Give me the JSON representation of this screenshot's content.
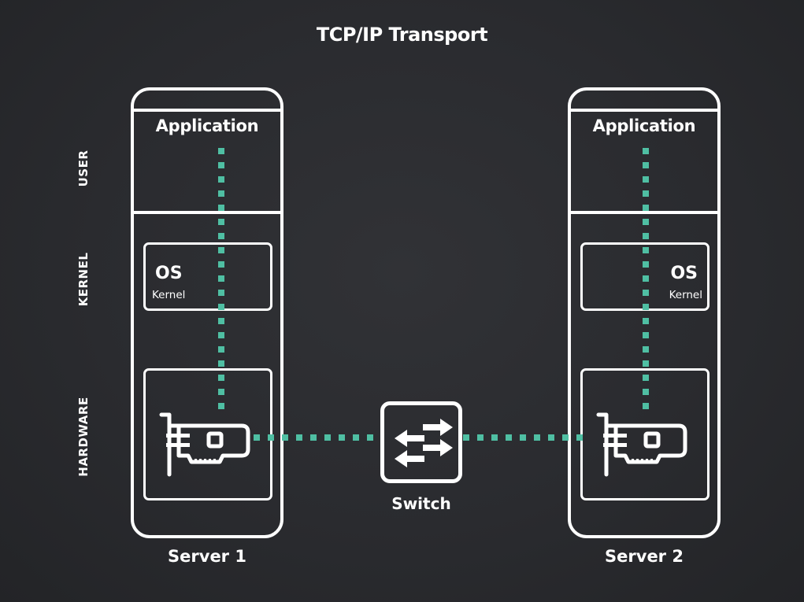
{
  "title": "TCP/IP Transport",
  "layers": [
    {
      "id": "user",
      "label": "USER"
    },
    {
      "id": "kernel",
      "label": "KERNEL"
    },
    {
      "id": "hardware",
      "label": "HARDWARE"
    }
  ],
  "servers": [
    {
      "name": "Server 1",
      "application_label": "Application",
      "os_label": "OS",
      "kernel_label": "Kernel",
      "nic_icon": "network-card-icon"
    },
    {
      "name": "Server 2",
      "application_label": "Application",
      "os_label": "OS",
      "kernel_label": "Kernel",
      "nic_icon": "network-card-icon"
    }
  ],
  "switch": {
    "label": "Switch",
    "icon": "arrows-exchange-icon"
  },
  "colors": {
    "background": "#2a2b2f",
    "foreground": "#ffffff",
    "data_path": "#4fbfa3"
  }
}
